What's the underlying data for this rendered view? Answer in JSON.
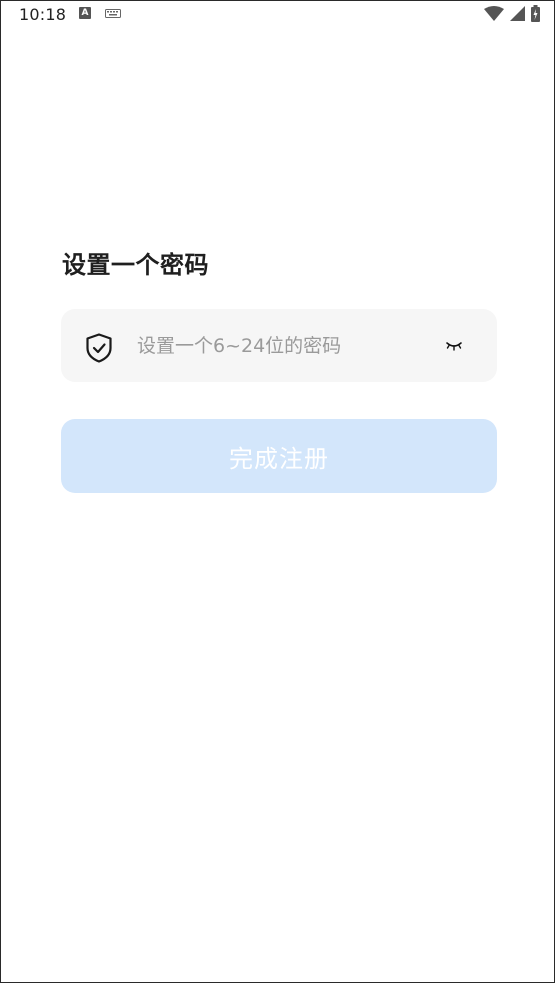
{
  "status_bar": {
    "time": "10:18",
    "notif_letter": "A",
    "icons": [
      "a-notification-icon",
      "keyboard-icon",
      "wifi-icon",
      "cell-signal-icon",
      "battery-icon"
    ]
  },
  "page": {
    "title": "设置一个密码"
  },
  "password_field": {
    "placeholder": "设置一个6~24位的密码",
    "value": "",
    "icon": "shield-check-icon",
    "toggle_icon": "eye-closed-icon"
  },
  "submit": {
    "label": "完成注册",
    "background": "#d3e6fb",
    "text_color": "#ffffff"
  },
  "colors": {
    "input_background": "#f6f6f6",
    "title": "#1f1f1f",
    "placeholder": "#9a9a9a"
  }
}
